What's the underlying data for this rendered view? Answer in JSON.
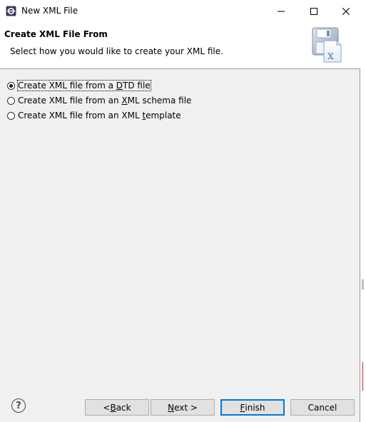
{
  "window": {
    "title": "New XML File",
    "icon": "eclipse-icon",
    "controls": {
      "minimize": "minimize-icon",
      "maximize": "maximize-icon",
      "close": "close-icon"
    }
  },
  "banner": {
    "title": "Create XML File From",
    "description": "Select how you would like to create your XML file.",
    "image": "xml-file-wizard-icon"
  },
  "options": [
    {
      "pre": "Create XML file from a ",
      "mnemonic": "D",
      "post": "TD file",
      "selected": true
    },
    {
      "pre": "Create XML file from an ",
      "mnemonic": "X",
      "post": "ML schema file",
      "selected": false
    },
    {
      "pre": "Create XML file from an XML ",
      "mnemonic": "t",
      "post": "emplate",
      "selected": false
    }
  ],
  "footer": {
    "help": "?",
    "back": {
      "pre": "< ",
      "mnemonic": "B",
      "post": "ack"
    },
    "next": {
      "pre": "",
      "mnemonic": "N",
      "post": "ext >"
    },
    "finish": {
      "pre": "",
      "mnemonic": "F",
      "post": "inish"
    },
    "cancel": "Cancel"
  },
  "colors": {
    "dialog_bg": "#f0f0f0",
    "default_button_border": "#0078d7"
  }
}
